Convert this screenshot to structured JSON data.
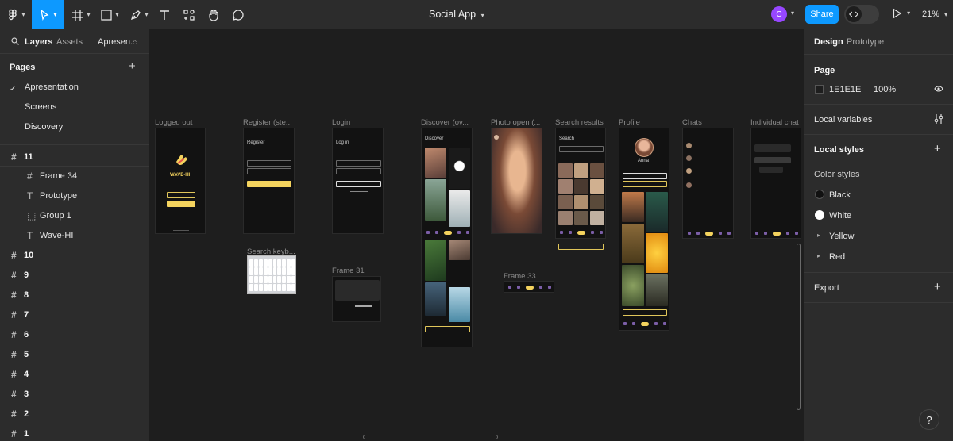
{
  "toolbar": {
    "file_title": "Social App",
    "share_label": "Share",
    "zoom_label": "21%",
    "user_initial": "C",
    "tools": [
      "main-menu",
      "move",
      "frame",
      "shape",
      "pen",
      "text",
      "resources",
      "hand",
      "comment"
    ]
  },
  "left_panel": {
    "tabs": [
      "Layers",
      "Assets",
      "Apresen..."
    ],
    "pages_heading": "Pages",
    "pages": [
      "Apresentation",
      "Screens",
      "Discovery"
    ],
    "layers": [
      {
        "label": "11",
        "type": "frame",
        "level": 0
      },
      {
        "label": "Frame 34",
        "type": "frame",
        "level": 1
      },
      {
        "label": "Prototype",
        "type": "text",
        "level": 1
      },
      {
        "label": "Group 1",
        "type": "group",
        "level": 1
      },
      {
        "label": "Wave-HI",
        "type": "text",
        "level": 1
      },
      {
        "label": "10",
        "type": "frame",
        "level": 0
      },
      {
        "label": "9",
        "type": "frame",
        "level": 0
      },
      {
        "label": "8",
        "type": "frame",
        "level": 0
      },
      {
        "label": "7",
        "type": "frame",
        "level": 0
      },
      {
        "label": "6",
        "type": "frame",
        "level": 0
      },
      {
        "label": "5",
        "type": "frame",
        "level": 0
      },
      {
        "label": "4",
        "type": "frame",
        "level": 0
      },
      {
        "label": "3",
        "type": "frame",
        "level": 0
      },
      {
        "label": "2",
        "type": "frame",
        "level": 0
      },
      {
        "label": "1",
        "type": "frame",
        "level": 0
      }
    ]
  },
  "canvas": {
    "frames": [
      {
        "label": "Logged out",
        "title": "",
        "brand": "WAVE-HI"
      },
      {
        "label": "Register (ste...",
        "title": "Register"
      },
      {
        "label": "Login",
        "title": "Log in"
      },
      {
        "label": "Discover (ov...",
        "title": "Discover"
      },
      {
        "label": "Photo open (...",
        "title": ""
      },
      {
        "label": "Search results",
        "title": "Search"
      },
      {
        "label": "Profile",
        "title": "Anna"
      },
      {
        "label": "Chats",
        "title": ""
      },
      {
        "label": "Individual chat",
        "title": ""
      },
      {
        "label": "Search keyb...",
        "title": ""
      },
      {
        "label": "Frame 31",
        "title": ""
      },
      {
        "label": "Frame 33",
        "title": ""
      }
    ]
  },
  "right_panel": {
    "tabs": [
      "Design",
      "Prototype"
    ],
    "page_heading": "Page",
    "page_color": "1E1E1E",
    "page_opacity": "100%",
    "local_variables": "Local variables",
    "local_styles": "Local styles",
    "color_styles": "Color styles",
    "styles": [
      {
        "name": "Black",
        "color": "#111111",
        "kind": "swatch"
      },
      {
        "name": "White",
        "color": "#ffffff",
        "kind": "swatch"
      },
      {
        "name": "Yellow",
        "color": "",
        "kind": "group"
      },
      {
        "name": "Red",
        "color": "",
        "kind": "group"
      }
    ],
    "export": "Export"
  },
  "colors": {
    "accent": "#0d99ff",
    "brand_yellow": "#f4d35e",
    "canvas": "#1e1e1e",
    "panel": "#2c2c2c"
  }
}
